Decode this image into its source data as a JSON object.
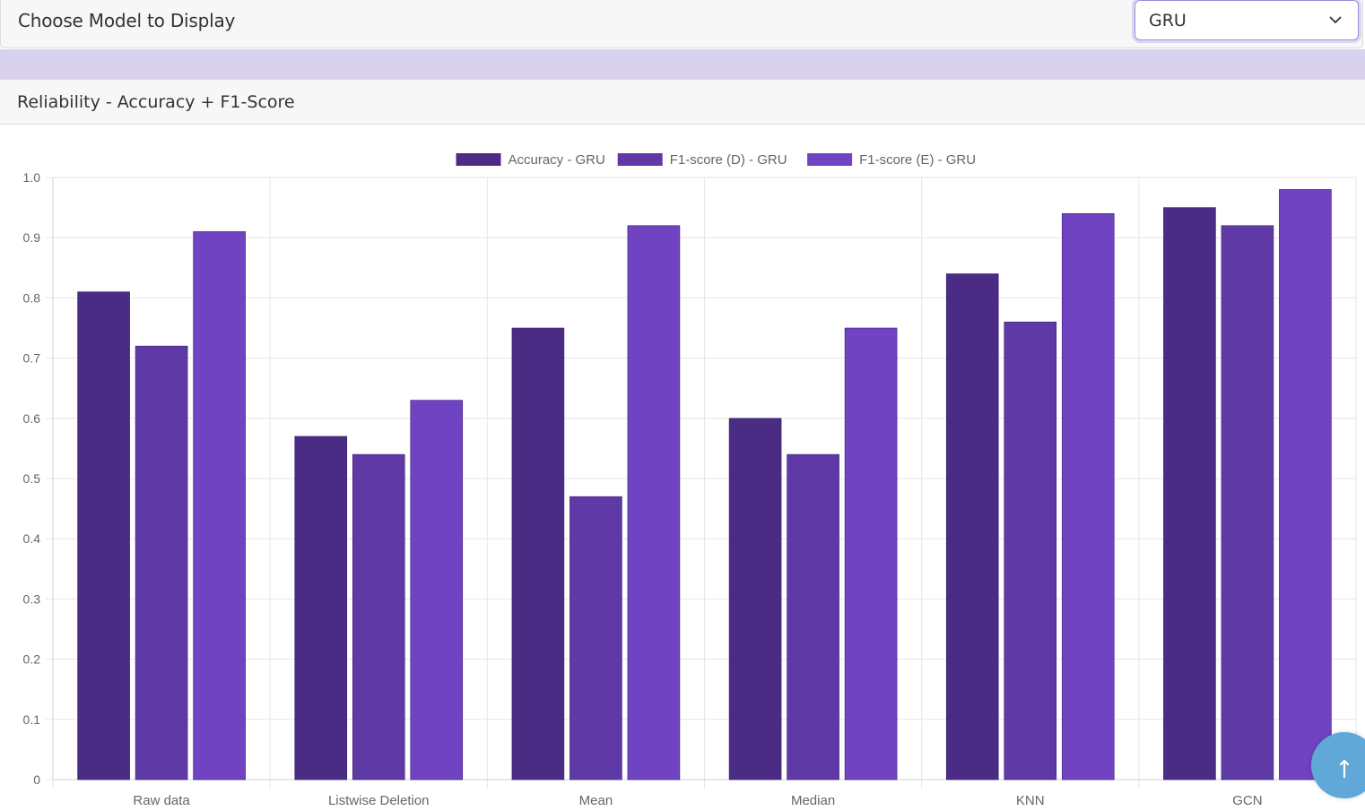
{
  "selector": {
    "label": "Choose Model to Display",
    "selected_model": "GRU",
    "icon": "chevron-down-icon"
  },
  "chart_card": {
    "title": "Reliability - Accuracy + F1-Score"
  },
  "scroll_top": {
    "icon": "arrow-up-icon"
  },
  "colors": {
    "band": "#d9d2ef",
    "grid": "#e6e6e6",
    "tick_text": "#666666"
  },
  "chart_data": {
    "type": "bar",
    "categories": [
      "Raw data",
      "Listwise Deletion",
      "Mean",
      "Median",
      "KNN",
      "GCN"
    ],
    "series": [
      {
        "name": "Accuracy - GRU",
        "color": "#4b2c85",
        "values": [
          0.81,
          0.57,
          0.75,
          0.6,
          0.84,
          0.95
        ]
      },
      {
        "name": "F1-score (D) - GRU",
        "color": "#5f3aa6",
        "values": [
          0.72,
          0.54,
          0.47,
          0.54,
          0.76,
          0.92
        ]
      },
      {
        "name": "F1-score (E) - GRU",
        "color": "#7043c2",
        "values": [
          0.91,
          0.63,
          0.92,
          0.75,
          0.94,
          0.98
        ]
      }
    ],
    "ylim": [
      0,
      1.0
    ],
    "yticks": [
      "0",
      "0.1",
      "0.2",
      "0.3",
      "0.4",
      "0.5",
      "0.6",
      "0.7",
      "0.8",
      "0.9",
      "1.0"
    ],
    "grid": true,
    "legend_position": "top-center"
  }
}
